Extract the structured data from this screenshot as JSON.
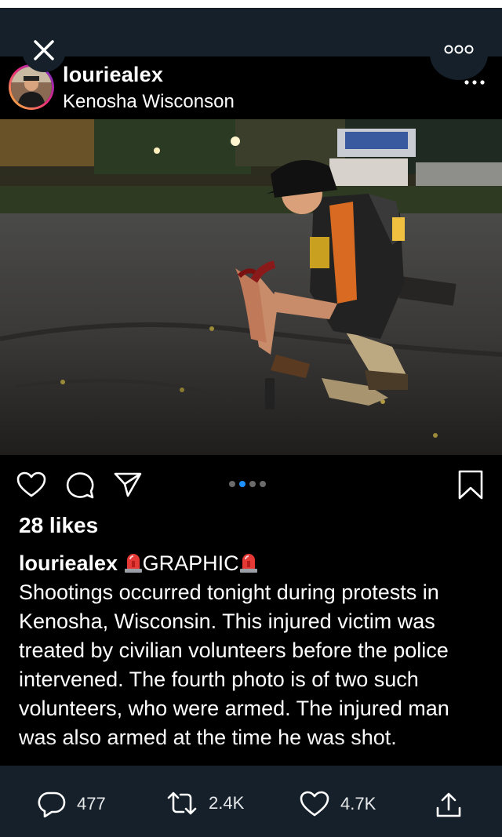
{
  "window": {
    "close_icon": "close-icon",
    "more_icon": "more-horizontal-circle-icon"
  },
  "post": {
    "username": "louriealex",
    "location": "Kenosha Wisconson",
    "likes": "28 likes",
    "caption": {
      "username": "louriealex",
      "tag": "GRAPHIC",
      "text": "Shootings occurred tonight during protests in Kenosha, Wisconsin. This injured victim was treated by civilian volunteers before the police intervened. The fourth photo is of two such volunteers, who were armed. The injured man was also armed at the time he was shot."
    },
    "carousel": {
      "count": 4,
      "active": 2
    },
    "actions": [
      "heart-icon",
      "comment-icon",
      "share-icon",
      "bookmark-icon"
    ]
  },
  "tweet_actions": {
    "replies": "477",
    "retweets": "2.4K",
    "likes": "4.7K"
  },
  "colors": {
    "background": "#15202b",
    "post_bg": "#000000",
    "active_dot": "#1e90ff"
  }
}
